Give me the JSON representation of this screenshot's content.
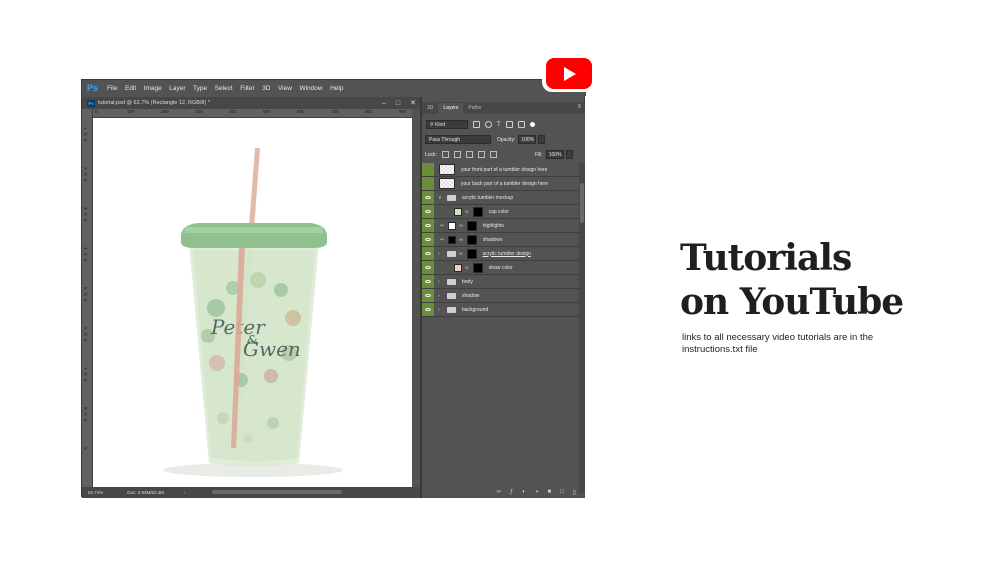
{
  "menubar": {
    "logo": "Ps",
    "items": [
      "File",
      "Edit",
      "Image",
      "Layer",
      "Type",
      "Select",
      "Filter",
      "3D",
      "View",
      "Window",
      "Help"
    ]
  },
  "document": {
    "tab_title": "tutorial.psd @ 62.7% (Rectangle 12, RGB/8) *",
    "status_zoom": "62.74%",
    "status_doc": "Doc: 5.93M/62.4M",
    "ruler_top": [
      "0",
      "100",
      "200",
      "300",
      "400",
      "500",
      "600",
      "700",
      "800",
      "900"
    ],
    "ruler_left": [
      "1",
      "0",
      "0",
      "2",
      "0",
      "0",
      "3",
      "0",
      "0",
      "4",
      "0",
      "0",
      "5",
      "0",
      "0",
      "6",
      "0",
      "0",
      "7",
      "0",
      "0",
      "8",
      "0",
      "0",
      "9"
    ]
  },
  "tumbler": {
    "design_text_line1": "Peter",
    "design_text_amp": "&",
    "design_text_line2": "Gwen"
  },
  "panel": {
    "tabs": [
      "3D",
      "Layers",
      "Paths"
    ],
    "active_tab": "Layers",
    "filter_kind": "Kind",
    "blend_mode": "Pass Through",
    "opacity_label": "Opacity:",
    "opacity_value": "100%",
    "lock_label": "Lock:",
    "fill_label": "Fill:",
    "fill_value": "100%",
    "layers": [
      {
        "name": "your front part of a tumbler design here"
      },
      {
        "name": "your back part of a tumbler design here"
      },
      {
        "name": "acrylic tumbler mockup"
      },
      {
        "name": "cap color"
      },
      {
        "name": "highlights"
      },
      {
        "name": "shadows"
      },
      {
        "name": "acrylic tumbler design"
      },
      {
        "name": "straw color"
      },
      {
        "name": "body"
      },
      {
        "name": "shadow"
      },
      {
        "name": "background"
      }
    ]
  },
  "promo": {
    "headline_line1": "Tutorials",
    "headline_line2": "on YouTube",
    "subtext": "links to all necessary video tutorials are in the instructions.txt file"
  },
  "colors": {
    "ps_bg": "#535353",
    "eye_green": "#6a8f3a",
    "youtube_red": "#ff0000",
    "headline": "#1f1f1f"
  }
}
